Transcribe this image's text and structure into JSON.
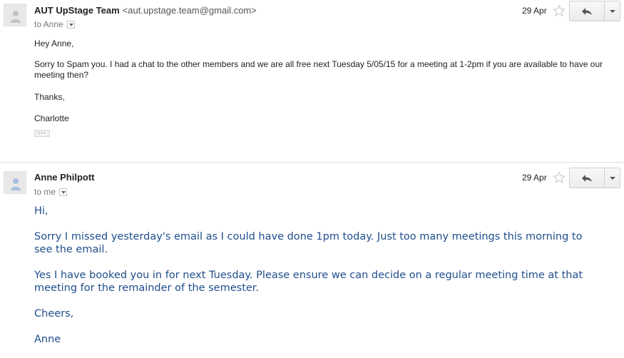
{
  "messages": [
    {
      "sender_name": "AUT UpStage Team",
      "sender_email": "<aut.upstage.team@gmail.com>",
      "recipient": "to Anne",
      "date": "29 Apr",
      "body": {
        "greeting": "Hey Anne,",
        "main": "Sorry to Spam you. I had a chat to the other members and we are all free next Tuesday 5/05/15 for a meeting at 1-2pm if you are available to have our meeting then?",
        "thanks": "Thanks,",
        "signature": "Charlotte"
      },
      "trimmed_content": "..."
    },
    {
      "sender_name": "Anne Philpott",
      "recipient": "to me",
      "date": "29 Apr",
      "body": {
        "greeting": "Hi,",
        "para1": "Sorry I missed yesterday's email as I could have done 1pm today. Just too many meetings this morning to see the email.",
        "para2": "Yes I have booked you in for next Tuesday. Please ensure we can decide on a regular meeting time at that meeting for the remainder of the semester.",
        "closing": "Cheers,",
        "signature": "Anne"
      }
    }
  ],
  "icons": {
    "avatar": "person-silhouette-icon",
    "star": "star-outline-icon",
    "reply": "reply-arrow-icon",
    "more": "chevron-down-icon"
  },
  "colors": {
    "reply_body_text": "#1f4e8c",
    "divider": "#e0e0e0"
  }
}
